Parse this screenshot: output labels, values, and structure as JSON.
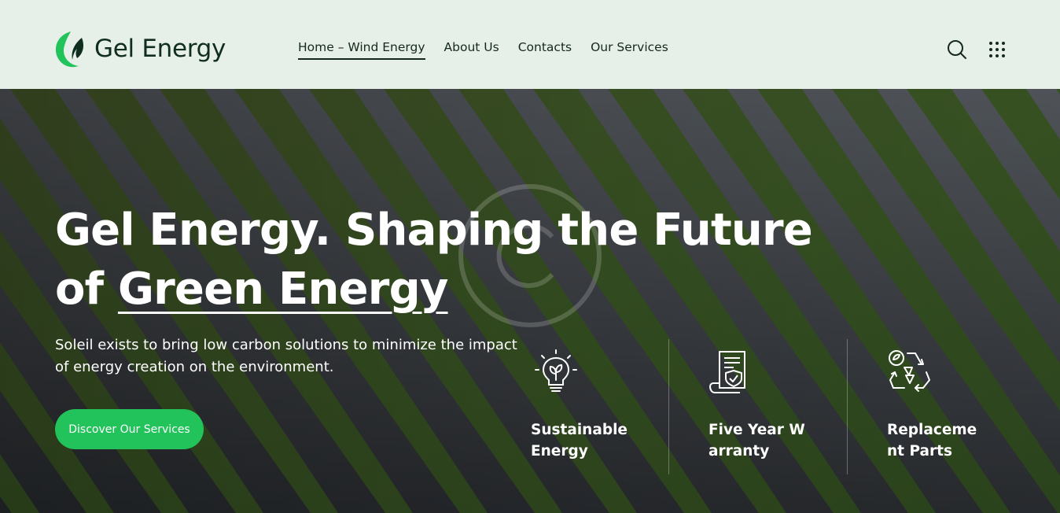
{
  "brand": {
    "name": "Gel Energy"
  },
  "nav": {
    "items": [
      {
        "label": "Home – Wind Energy",
        "active": true
      },
      {
        "label": "About Us",
        "active": false
      },
      {
        "label": "Contacts",
        "active": false
      },
      {
        "label": "Our Services",
        "active": false
      }
    ]
  },
  "header_icons": {
    "search": "search-icon",
    "menu": "grid-menu-icon"
  },
  "hero": {
    "title_part1": "Gel Energy. Shaping the Future",
    "title_part2": "of ",
    "title_highlight": "Green Energy",
    "description": "Soleil exists to bring low carbon solutions to minimize the impact of energy creation on the environment.",
    "cta_label": "Discover Our Services"
  },
  "features": [
    {
      "icon": "lightbulb-leaf-icon",
      "label": "Sustainable Energy"
    },
    {
      "icon": "warranty-document-icon",
      "label": "Five Year Warranty"
    },
    {
      "icon": "recycle-parts-icon",
      "label": "Replacement Parts"
    }
  ],
  "colors": {
    "header_bg": "#e7f0e8",
    "accent_green": "#22c35a",
    "brand_dark": "#0f2e1d"
  }
}
